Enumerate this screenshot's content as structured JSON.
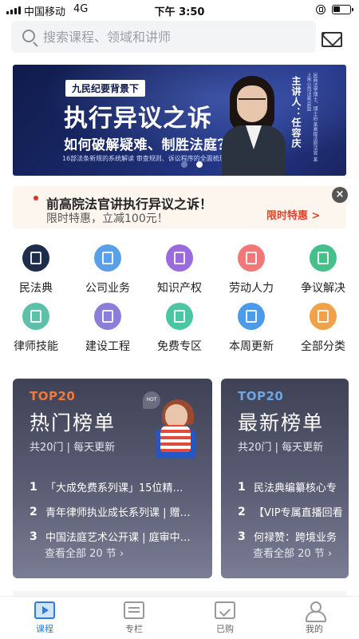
{
  "status_bar": {
    "carrier": "中国移动",
    "network": "4G",
    "time": "下午 3:50"
  },
  "search": {
    "placeholder": "搜索课程、领域和讲师"
  },
  "banner": {
    "tag": "九民纪要背景下",
    "title": "执行异议之诉",
    "subtitle": "如何破解疑难、制胜法庭？",
    "desc": "16部法条新规的系统解读  审查规则、诉讼程序的全面梳理",
    "speaker": "主讲人：任容庆",
    "speaker_info": "民商法学博士、博士后 某高级法院法官 某上市公司法务总监",
    "page_count": 2,
    "active_page": 2
  },
  "promo": {
    "title": "前高院法官讲执行异议之诉！",
    "subtitle": "限时特惠，立减100元！",
    "button": "限时特惠 >",
    "close": "×"
  },
  "categories": [
    {
      "label": "民法典",
      "icon": "civil-code-icon",
      "color": "#1f2d4d"
    },
    {
      "label": "公司业务",
      "icon": "company-icon",
      "color": "#5aa0e8"
    },
    {
      "label": "知识产权",
      "icon": "graduation-cap-icon",
      "color": "#9a6bdc"
    },
    {
      "label": "劳动人力",
      "icon": "document-icon",
      "color": "#f07878"
    },
    {
      "label": "争议解决",
      "icon": "scales-icon",
      "color": "#46c08a"
    },
    {
      "label": "律师技能",
      "icon": "certificate-icon",
      "color": "#5ec0a8"
    },
    {
      "label": "建设工程",
      "icon": "building-icon",
      "color": "#8a7fd8"
    },
    {
      "label": "免费专区",
      "icon": "free-icon",
      "color": "#4bc6a2"
    },
    {
      "label": "本周更新",
      "icon": "clock-icon",
      "color": "#4d9be8"
    },
    {
      "label": "全部分类",
      "icon": "list-icon",
      "color": "#f0a24a"
    }
  ],
  "rankings": [
    {
      "badge": "TOP20",
      "title": "热门榜单",
      "meta": "共20门 | 每天更新",
      "items": [
        {
          "rank": "1",
          "text": "「大成免费系列课」15位精…"
        },
        {
          "rank": "2",
          "text": "青年律师执业成长系列课 | 赠…"
        },
        {
          "rank": "3",
          "text": "中国法庭艺术公开课 | 庭审中…"
        }
      ],
      "more": "查看全部 20 节 ›"
    },
    {
      "badge": "TOP20",
      "title": "最新榜单",
      "meta": "共20门 | 每天更新",
      "items": [
        {
          "rank": "1",
          "text": "民法典编纂核心专"
        },
        {
          "rank": "2",
          "text": "【VIP专属直播回看"
        },
        {
          "rank": "3",
          "text": "何禄赞：跨境业务"
        }
      ],
      "more": "查看全部 20 节 ›"
    }
  ],
  "tabbar": [
    {
      "label": "课程",
      "icon": "video-course-icon",
      "active": true
    },
    {
      "label": "专栏",
      "icon": "column-icon",
      "active": false
    },
    {
      "label": "已购",
      "icon": "purchased-icon",
      "active": false
    },
    {
      "label": "我的",
      "icon": "profile-icon",
      "active": false
    }
  ],
  "colors": {
    "accent": "#2b7de0",
    "promo_red": "#e0452a",
    "banner_bg": "#1a2a6a"
  }
}
